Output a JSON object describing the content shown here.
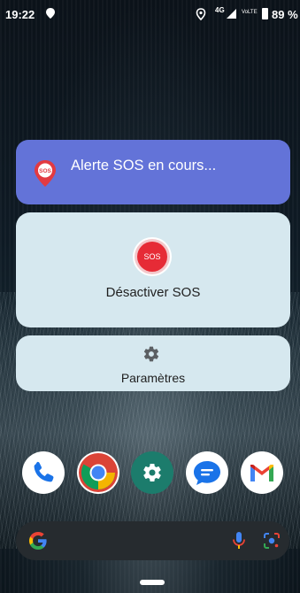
{
  "status_bar": {
    "time": "19:22",
    "network": "4G",
    "volte": "VoLTE",
    "battery": "89 %"
  },
  "sos_banner": {
    "title": "Alerte SOS en cours...",
    "pin_label": "SOS",
    "icon": "sos-location-pin-icon",
    "color": "#6373d8"
  },
  "deactivate_card": {
    "button_text": "SOS",
    "label": "Désactiver SOS",
    "button_color": "#e62b36"
  },
  "settings_card": {
    "icon": "gear-icon",
    "label": "Paramètres"
  },
  "dock": {
    "apps": [
      {
        "name": "phone-app-icon"
      },
      {
        "name": "chrome-app-icon"
      },
      {
        "name": "settings-app-icon"
      },
      {
        "name": "messages-app-icon"
      },
      {
        "name": "gmail-app-icon"
      }
    ]
  },
  "search_bar": {
    "icons": [
      "google-g-icon",
      "microphone-icon",
      "google-lens-icon"
    ]
  }
}
